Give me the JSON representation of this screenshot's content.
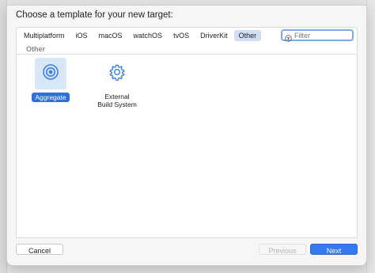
{
  "sheet": {
    "title": "Choose a template for your new target:"
  },
  "tabs": [
    {
      "label": "Multiplatform",
      "selected": false
    },
    {
      "label": "iOS",
      "selected": false
    },
    {
      "label": "macOS",
      "selected": false
    },
    {
      "label": "watchOS",
      "selected": false
    },
    {
      "label": "tvOS",
      "selected": false
    },
    {
      "label": "DriverKit",
      "selected": false
    },
    {
      "label": "Other",
      "selected": true
    }
  ],
  "filter": {
    "placeholder": "Filter",
    "value": ""
  },
  "section": {
    "title": "Other"
  },
  "templates": [
    {
      "label": "Aggregate",
      "icon": "aggregate-target-icon",
      "selected": true
    },
    {
      "label_line1": "External",
      "label_line2": "Build System",
      "icon": "gear-icon",
      "selected": false
    }
  ],
  "buttons": {
    "cancel": "Cancel",
    "previous": "Previous",
    "next": "Next"
  },
  "colors": {
    "accent": "#3579ee",
    "selection": "#2f6fd6",
    "tab_selected_bg": "#d0dff3",
    "icon_blue": "#3a7ee8"
  }
}
